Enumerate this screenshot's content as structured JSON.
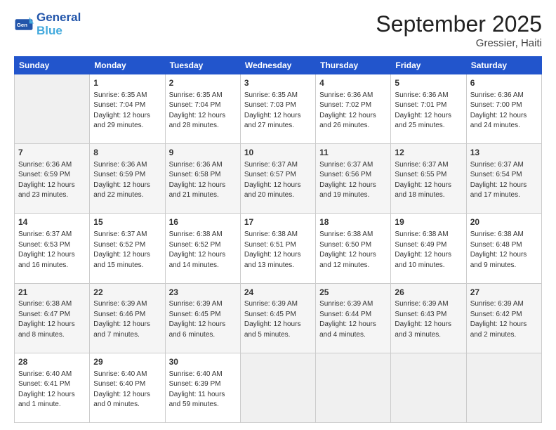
{
  "header": {
    "logo_text_1": "General",
    "logo_text_2": "Blue",
    "month": "September 2025",
    "location": "Gressier, Haiti"
  },
  "weekdays": [
    "Sunday",
    "Monday",
    "Tuesday",
    "Wednesday",
    "Thursday",
    "Friday",
    "Saturday"
  ],
  "weeks": [
    [
      {
        "day": "",
        "info": ""
      },
      {
        "day": "1",
        "info": "Sunrise: 6:35 AM\nSunset: 7:04 PM\nDaylight: 12 hours\nand 29 minutes."
      },
      {
        "day": "2",
        "info": "Sunrise: 6:35 AM\nSunset: 7:04 PM\nDaylight: 12 hours\nand 28 minutes."
      },
      {
        "day": "3",
        "info": "Sunrise: 6:35 AM\nSunset: 7:03 PM\nDaylight: 12 hours\nand 27 minutes."
      },
      {
        "day": "4",
        "info": "Sunrise: 6:36 AM\nSunset: 7:02 PM\nDaylight: 12 hours\nand 26 minutes."
      },
      {
        "day": "5",
        "info": "Sunrise: 6:36 AM\nSunset: 7:01 PM\nDaylight: 12 hours\nand 25 minutes."
      },
      {
        "day": "6",
        "info": "Sunrise: 6:36 AM\nSunset: 7:00 PM\nDaylight: 12 hours\nand 24 minutes."
      }
    ],
    [
      {
        "day": "7",
        "info": "Sunrise: 6:36 AM\nSunset: 6:59 PM\nDaylight: 12 hours\nand 23 minutes."
      },
      {
        "day": "8",
        "info": "Sunrise: 6:36 AM\nSunset: 6:59 PM\nDaylight: 12 hours\nand 22 minutes."
      },
      {
        "day": "9",
        "info": "Sunrise: 6:36 AM\nSunset: 6:58 PM\nDaylight: 12 hours\nand 21 minutes."
      },
      {
        "day": "10",
        "info": "Sunrise: 6:37 AM\nSunset: 6:57 PM\nDaylight: 12 hours\nand 20 minutes."
      },
      {
        "day": "11",
        "info": "Sunrise: 6:37 AM\nSunset: 6:56 PM\nDaylight: 12 hours\nand 19 minutes."
      },
      {
        "day": "12",
        "info": "Sunrise: 6:37 AM\nSunset: 6:55 PM\nDaylight: 12 hours\nand 18 minutes."
      },
      {
        "day": "13",
        "info": "Sunrise: 6:37 AM\nSunset: 6:54 PM\nDaylight: 12 hours\nand 17 minutes."
      }
    ],
    [
      {
        "day": "14",
        "info": "Sunrise: 6:37 AM\nSunset: 6:53 PM\nDaylight: 12 hours\nand 16 minutes."
      },
      {
        "day": "15",
        "info": "Sunrise: 6:37 AM\nSunset: 6:52 PM\nDaylight: 12 hours\nand 15 minutes."
      },
      {
        "day": "16",
        "info": "Sunrise: 6:38 AM\nSunset: 6:52 PM\nDaylight: 12 hours\nand 14 minutes."
      },
      {
        "day": "17",
        "info": "Sunrise: 6:38 AM\nSunset: 6:51 PM\nDaylight: 12 hours\nand 13 minutes."
      },
      {
        "day": "18",
        "info": "Sunrise: 6:38 AM\nSunset: 6:50 PM\nDaylight: 12 hours\nand 12 minutes."
      },
      {
        "day": "19",
        "info": "Sunrise: 6:38 AM\nSunset: 6:49 PM\nDaylight: 12 hours\nand 10 minutes."
      },
      {
        "day": "20",
        "info": "Sunrise: 6:38 AM\nSunset: 6:48 PM\nDaylight: 12 hours\nand 9 minutes."
      }
    ],
    [
      {
        "day": "21",
        "info": "Sunrise: 6:38 AM\nSunset: 6:47 PM\nDaylight: 12 hours\nand 8 minutes."
      },
      {
        "day": "22",
        "info": "Sunrise: 6:39 AM\nSunset: 6:46 PM\nDaylight: 12 hours\nand 7 minutes."
      },
      {
        "day": "23",
        "info": "Sunrise: 6:39 AM\nSunset: 6:45 PM\nDaylight: 12 hours\nand 6 minutes."
      },
      {
        "day": "24",
        "info": "Sunrise: 6:39 AM\nSunset: 6:45 PM\nDaylight: 12 hours\nand 5 minutes."
      },
      {
        "day": "25",
        "info": "Sunrise: 6:39 AM\nSunset: 6:44 PM\nDaylight: 12 hours\nand 4 minutes."
      },
      {
        "day": "26",
        "info": "Sunrise: 6:39 AM\nSunset: 6:43 PM\nDaylight: 12 hours\nand 3 minutes."
      },
      {
        "day": "27",
        "info": "Sunrise: 6:39 AM\nSunset: 6:42 PM\nDaylight: 12 hours\nand 2 minutes."
      }
    ],
    [
      {
        "day": "28",
        "info": "Sunrise: 6:40 AM\nSunset: 6:41 PM\nDaylight: 12 hours\nand 1 minute."
      },
      {
        "day": "29",
        "info": "Sunrise: 6:40 AM\nSunset: 6:40 PM\nDaylight: 12 hours\nand 0 minutes."
      },
      {
        "day": "30",
        "info": "Sunrise: 6:40 AM\nSunset: 6:39 PM\nDaylight: 11 hours\nand 59 minutes."
      },
      {
        "day": "",
        "info": ""
      },
      {
        "day": "",
        "info": ""
      },
      {
        "day": "",
        "info": ""
      },
      {
        "day": "",
        "info": ""
      }
    ]
  ]
}
